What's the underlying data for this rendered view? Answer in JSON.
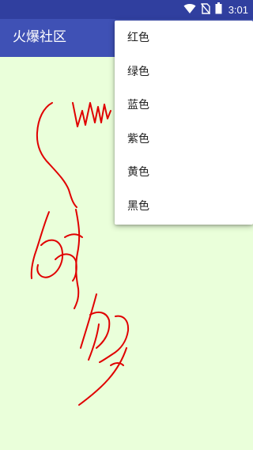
{
  "status_bar": {
    "time": "3:01",
    "icons": [
      "wifi-icon",
      "no-sim-icon",
      "battery-icon"
    ],
    "background_color": "#303f9f"
  },
  "app_bar": {
    "title": "火爆社区",
    "background_color": "#3f51b5"
  },
  "canvas": {
    "background_color": "#eaffda",
    "stroke_color": "#e00000"
  },
  "overflow_menu": {
    "items": [
      {
        "label": "红色"
      },
      {
        "label": "绿色"
      },
      {
        "label": "蓝色"
      },
      {
        "label": "紫色"
      },
      {
        "label": "黄色"
      },
      {
        "label": "黑色"
      }
    ]
  }
}
